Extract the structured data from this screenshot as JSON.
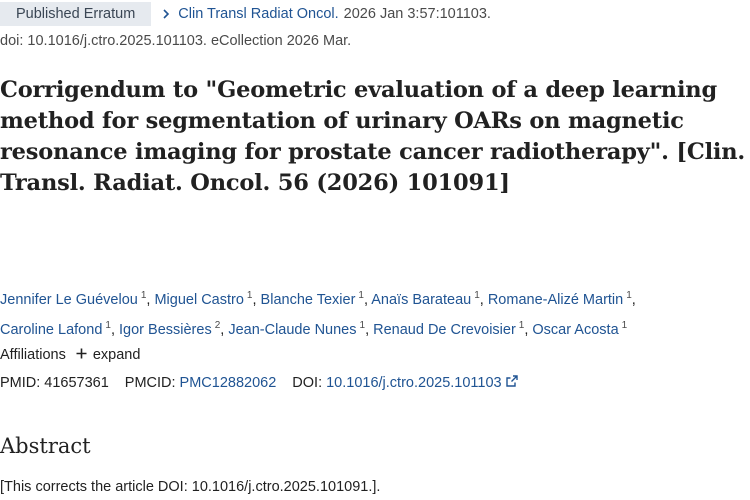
{
  "header": {
    "badge": "Published Erratum",
    "journal": "Clin Transl Radiat Oncol.",
    "citation": "2026 Jan 3:57:101103.",
    "doi_line": "doi: 10.1016/j.ctro.2025.101103. eCollection 2026 Mar."
  },
  "title": "Corrigendum to \"Geometric evaluation of a deep learning method for segmentation of urinary OARs on magnetic resonance imaging for prostate cancer radiotherapy\". [Clin. Transl. Radiat. Oncol. 56 (2026) 101091]",
  "authors": [
    {
      "name": "Jennifer Le Guévelou",
      "aff": "1"
    },
    {
      "name": "Miguel Castro",
      "aff": "1"
    },
    {
      "name": "Blanche Texier",
      "aff": "1"
    },
    {
      "name": "Anaïs Barateau",
      "aff": "1"
    },
    {
      "name": "Romane-Alizé Martin",
      "aff": "1"
    },
    {
      "name": "Caroline Lafond",
      "aff": "1"
    },
    {
      "name": "Igor Bessières",
      "aff": "2"
    },
    {
      "name": "Jean-Claude Nunes",
      "aff": "1"
    },
    {
      "name": "Renaud De Crevoisier",
      "aff": "1"
    },
    {
      "name": "Oscar Acosta",
      "aff": "1"
    }
  ],
  "affiliations": {
    "label": "Affiliations",
    "expand_label": "expand"
  },
  "ids": {
    "pmid_label": "PMID:",
    "pmid": "41657361",
    "pmcid_label": "PMCID:",
    "pmcid": "PMC12882062",
    "doi_label": "DOI:",
    "doi": "10.1016/j.ctro.2025.101103"
  },
  "abstract": {
    "heading": "Abstract",
    "text": "[This corrects the article DOI: 10.1016/j.ctro.2025.101091.]."
  },
  "icons": {
    "breadcrumb": "chevron-right-icon",
    "expand": "plus-icon",
    "external": "external-link-icon"
  },
  "colors": {
    "link": "#205493",
    "badge_bg": "#e6eaef",
    "text": "#212121"
  }
}
